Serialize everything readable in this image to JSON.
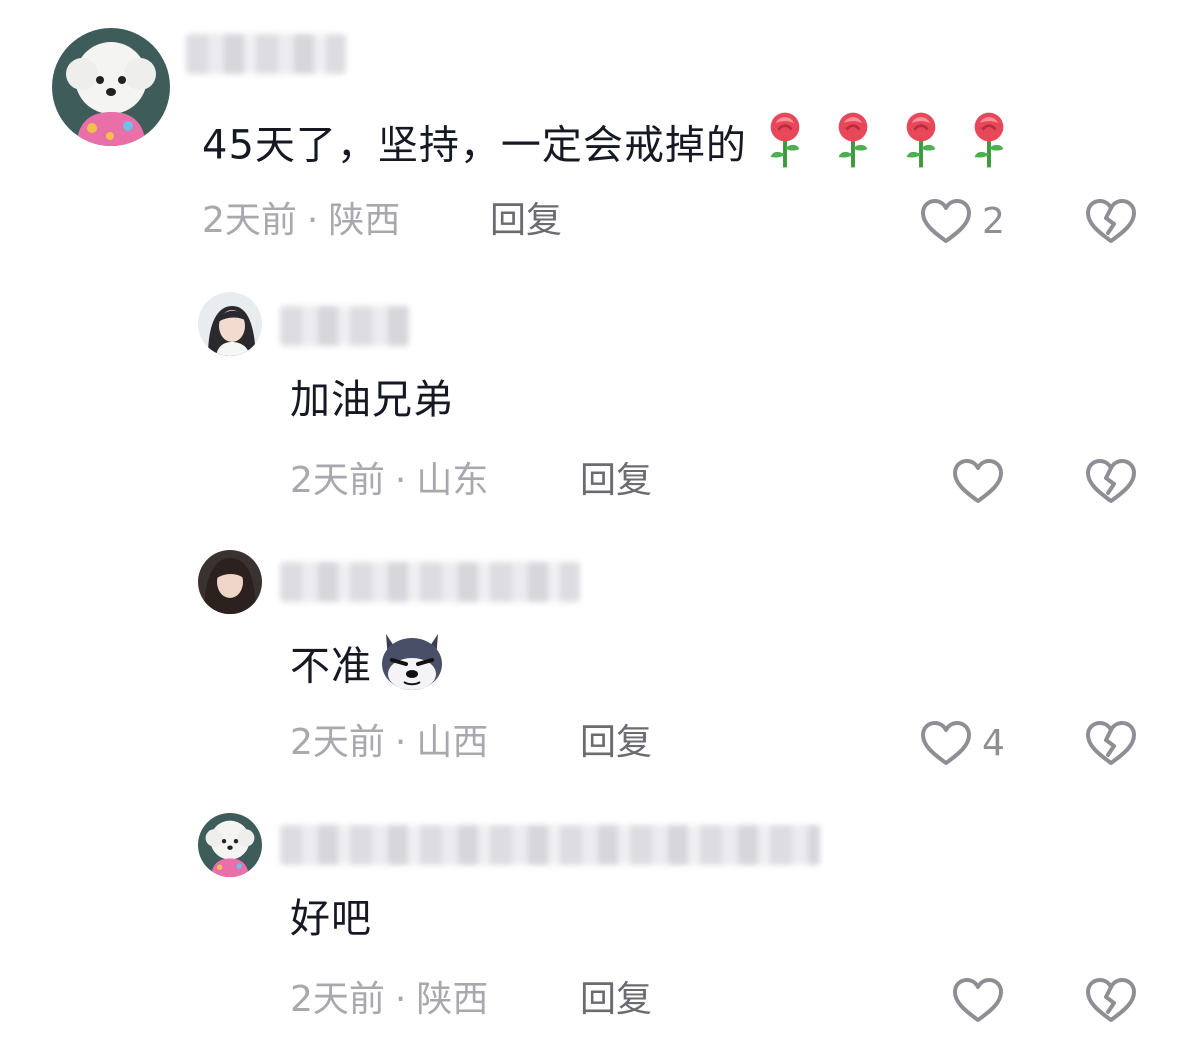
{
  "comments": [
    {
      "text": "45天了，坚持，一定会戒掉的",
      "emoji": "rose-icon",
      "time": "2天前",
      "separator": "·",
      "location": "陕西",
      "reply": "回复",
      "likes": "2"
    },
    {
      "text": "加油兄弟",
      "time": "2天前",
      "separator": "·",
      "location": "山东",
      "reply": "回复",
      "likes": ""
    },
    {
      "text": "不准",
      "emoji": "husky-dog-icon",
      "time": "2天前",
      "separator": "·",
      "location": "山西",
      "reply": "回复",
      "likes": "4"
    },
    {
      "text": "好吧",
      "time": "2天前",
      "separator": "·",
      "location": "陕西",
      "reply": "回复",
      "likes": ""
    }
  ],
  "icons": {
    "like": "heart-outline-icon",
    "dislike": "broken-heart-icon"
  },
  "colors": {
    "text": "#161823",
    "meta": "#a8a8ae",
    "reply": "#6b6b72",
    "icon": "#8e8e94"
  }
}
